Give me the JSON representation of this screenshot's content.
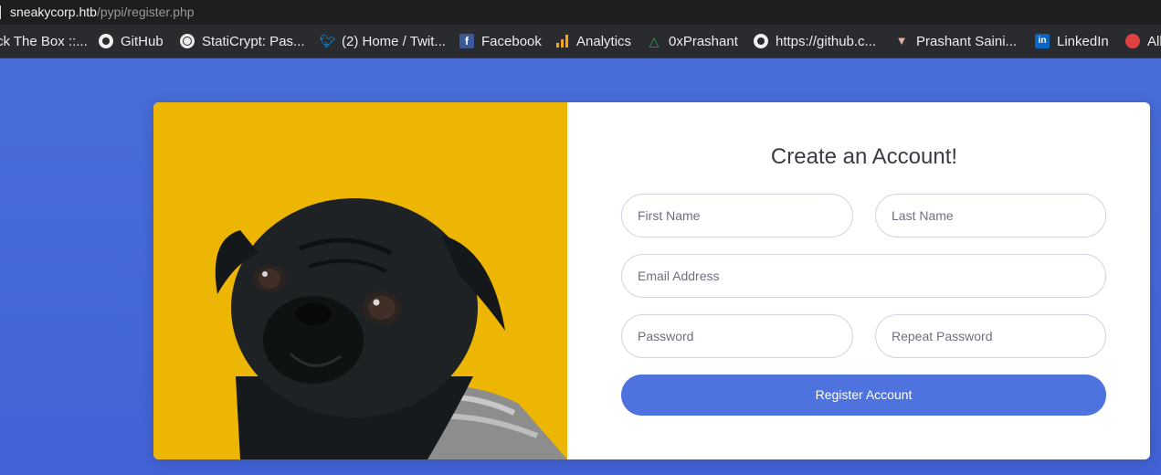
{
  "address_bar": {
    "host": "sneakycorp.htb",
    "path": "/pypi/register.php"
  },
  "bookmarks": [
    {
      "label": "ck The Box ::...",
      "icon": "hackthebox-icon"
    },
    {
      "label": "GitHub",
      "icon": "github-icon"
    },
    {
      "label": "StatiCrypt: Pas...",
      "icon": "globe-icon"
    },
    {
      "label": "(2) Home / Twit...",
      "icon": "twitter-icon"
    },
    {
      "label": "Facebook",
      "icon": "facebook-icon"
    },
    {
      "label": "Analytics",
      "icon": "analytics-icon"
    },
    {
      "label": "0xPrashant",
      "icon": "triangle-icon"
    },
    {
      "label": "https://github.c...",
      "icon": "github-icon"
    },
    {
      "label": "Prashant Saini...",
      "icon": "drop-icon"
    },
    {
      "label": "LinkedIn",
      "icon": "linkedin-icon"
    },
    {
      "label": "All",
      "icon": "red-circle-icon"
    }
  ],
  "register": {
    "title": "Create an Account!",
    "first_name_placeholder": "First Name",
    "last_name_placeholder": "Last Name",
    "email_placeholder": "Email Address",
    "password_placeholder": "Password",
    "repeat_password_placeholder": "Repeat Password",
    "submit_label": "Register Account"
  },
  "colors": {
    "background": "#4a6fd9",
    "photo_bg": "#edb605",
    "button": "#4e73df"
  }
}
